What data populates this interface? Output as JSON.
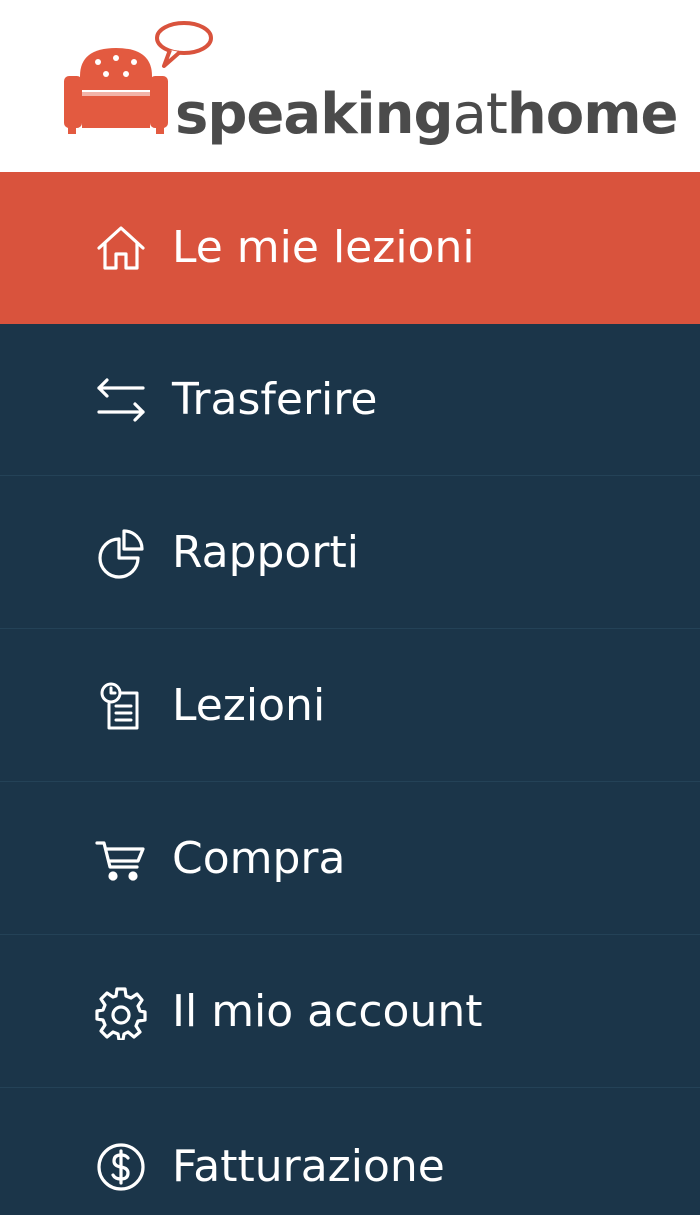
{
  "brand": {
    "name_part1": "speaking",
    "name_part2": "at",
    "name_part3": "home",
    "logo_icon": "armchair-speech-bubble-logo",
    "accent_color": "#d9533d",
    "text_color": "#4b4b4b"
  },
  "theme": {
    "sidebar_background": "#1b3549",
    "active_background": "#d9533d",
    "label_color": "#ffffff"
  },
  "nav": {
    "items": [
      {
        "label": "Le mie lezioni",
        "icon": "home-icon",
        "active": true
      },
      {
        "label": "Trasferire",
        "icon": "transfer-arrows-icon",
        "active": false
      },
      {
        "label": "Rapporti",
        "icon": "pie-chart-icon",
        "active": false
      },
      {
        "label": "Lezioni",
        "icon": "lessons-document-icon",
        "active": false
      },
      {
        "label": "Compra",
        "icon": "cart-icon",
        "active": false
      },
      {
        "label": "Il mio account",
        "icon": "gear-icon",
        "active": false
      },
      {
        "label": "Fatturazione",
        "icon": "dollar-coin-icon",
        "active": false
      }
    ]
  }
}
